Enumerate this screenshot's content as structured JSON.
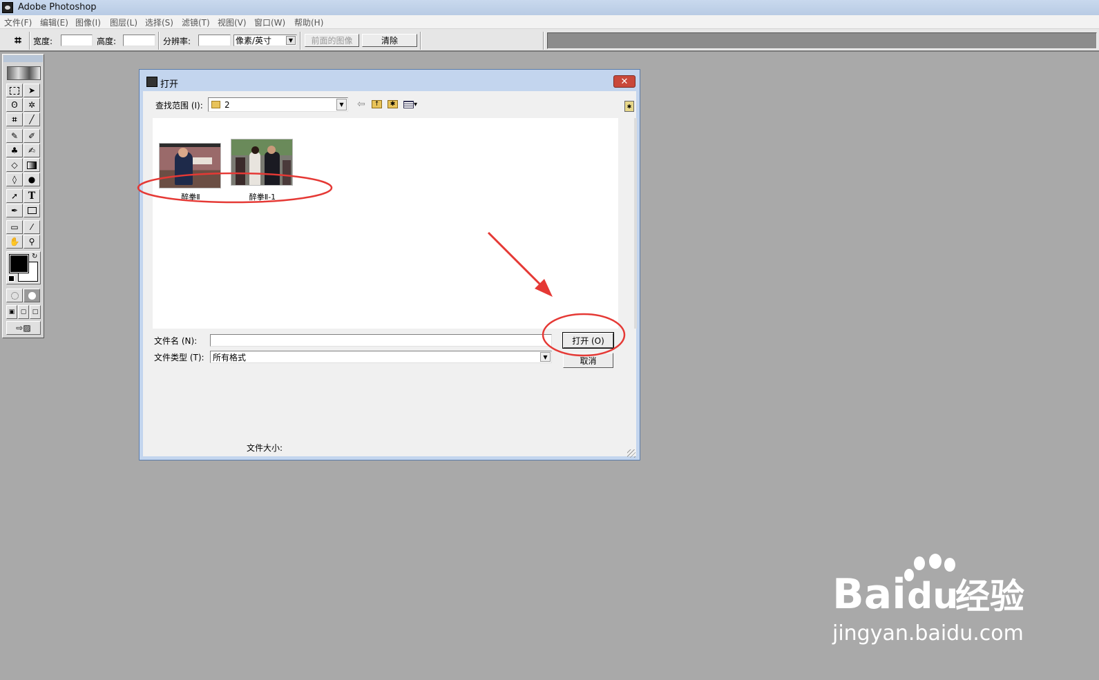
{
  "window": {
    "title": "Adobe Photoshop"
  },
  "menu": [
    {
      "label": "文件(F)"
    },
    {
      "label": "编辑(E)"
    },
    {
      "label": "图像(I)"
    },
    {
      "label": "图层(L)"
    },
    {
      "label": "选择(S)"
    },
    {
      "label": "滤镜(T)"
    },
    {
      "label": "视图(V)"
    },
    {
      "label": "窗口(W)"
    },
    {
      "label": "帮助(H)"
    }
  ],
  "options_bar": {
    "width_label": "宽度:",
    "height_label": "高度:",
    "resolution_label": "分辨率:",
    "unit_value": "像素/英寸",
    "front_image_label": "前面的图像",
    "clear_label": "清除"
  },
  "toolbox": {
    "tools": [
      "marquee-icon",
      "move-icon",
      "lasso-icon",
      "magic-wand-icon",
      "crop-icon",
      "slice-icon",
      "brush-icon",
      "pencil-icon",
      "stamp-icon",
      "history-brush-icon",
      "eraser-icon",
      "gradient-icon",
      "blur-icon",
      "dodge-icon",
      "path-select-icon",
      "type-icon",
      "pen-icon",
      "shape-icon",
      "notes-icon",
      "eyedropper-icon",
      "hand-icon",
      "zoom-icon"
    ],
    "type_glyph": "T"
  },
  "dialog": {
    "title": "打开",
    "look_in_label": "查找范围 (I):",
    "look_in_value": "2",
    "files": [
      {
        "name": "醉拳Ⅱ"
      },
      {
        "name": "醉拳Ⅱ-1"
      }
    ],
    "filename_label": "文件名 (N):",
    "filename_value": "",
    "filetype_label": "文件类型 (T):",
    "filetype_value": "所有格式",
    "open_label": "打开 (O)",
    "cancel_label": "取消",
    "filesize_label": "文件大小:"
  },
  "watermark": {
    "brand": "Bai",
    "brand_tail": "du",
    "suffix": "经验",
    "url": "jingyan.baidu.com"
  },
  "colors": {
    "annotation": "#e53935",
    "title_bar": "#c3d5ee",
    "workspace": "#a9a9a9"
  }
}
